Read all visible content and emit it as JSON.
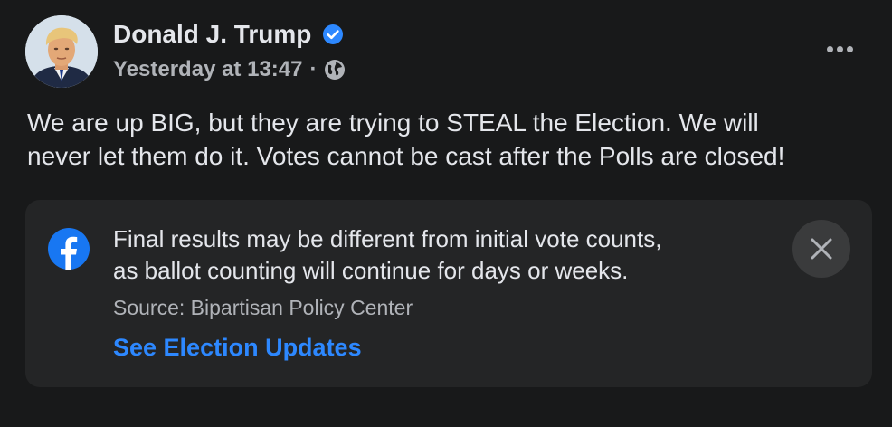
{
  "post": {
    "author": "Donald J. Trump",
    "verified_icon": "verified-badge-icon",
    "timestamp": "Yesterday at 13:47",
    "separator": "·",
    "privacy_icon": "globe-icon",
    "more_icon": "more-options-icon",
    "text_lines": [
      "We are up BIG, but they are trying to STEAL the Election. We will",
      "never let them do it. Votes cannot be cast after the Polls are closed!"
    ]
  },
  "info_card": {
    "icon": "facebook-logo-icon",
    "lines": [
      "Final results may be different from initial vote counts,",
      "as ballot counting will continue for days or weeks."
    ],
    "source": "Source: Bipartisan Policy Center",
    "link_label": "See Election Updates",
    "close_icon": "close-icon"
  },
  "colors": {
    "background": "#18191a",
    "card": "#242526",
    "primary_text": "#e4e6eb",
    "secondary_text": "#b0b3b8",
    "link": "#2d88ff",
    "verified": "#2d88ff",
    "facebook_blue": "#1877f2"
  }
}
